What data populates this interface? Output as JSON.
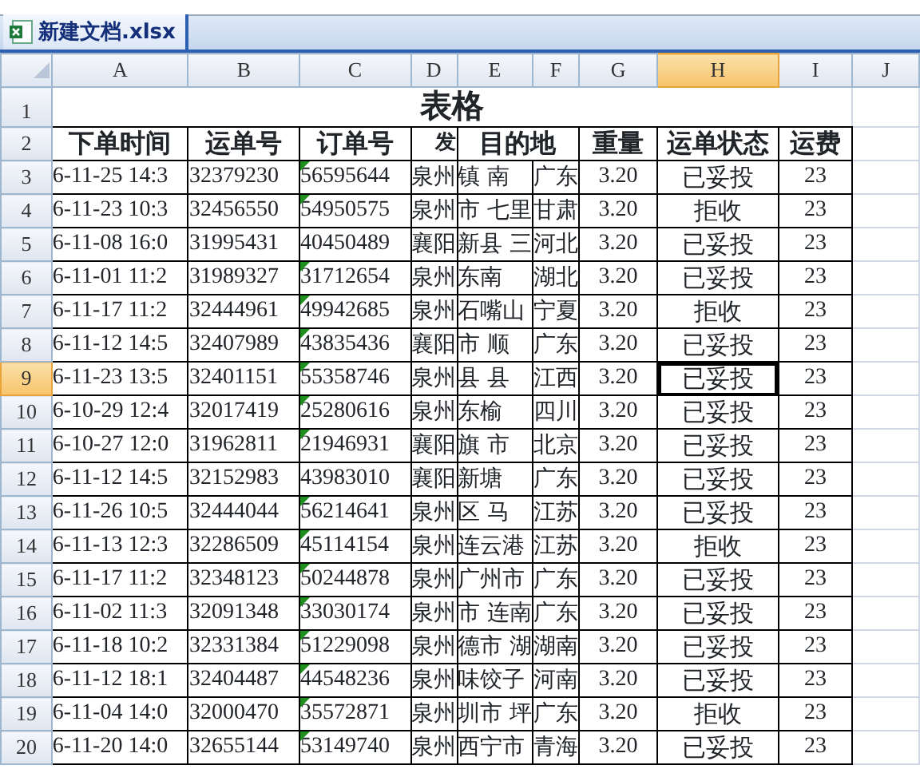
{
  "tab": {
    "label": "新建文档.xlsx",
    "selected": true
  },
  "columns": [
    {
      "label": "A",
      "selected": false
    },
    {
      "label": "B",
      "selected": false
    },
    {
      "label": "C",
      "selected": false
    },
    {
      "label": "D",
      "selected": false
    },
    {
      "label": "E",
      "selected": false
    },
    {
      "label": "F",
      "selected": false
    },
    {
      "label": "G",
      "selected": false
    },
    {
      "label": "H",
      "selected": true
    },
    {
      "label": "I",
      "selected": false
    },
    {
      "label": "J",
      "selected": false
    }
  ],
  "title_row": {
    "number": "1",
    "title": "表格"
  },
  "header_row": {
    "number": "2",
    "cells": [
      "下单时间",
      "运单号",
      "订单号",
      "发",
      "目的地",
      "重量",
      "运单状态",
      "运费"
    ]
  },
  "rows": [
    {
      "number": "3",
      "selected": false,
      "flagged": true,
      "cells": [
        "6-11-25 14:3",
        "32379230",
        "56595644",
        "泉州",
        "镇 南",
        "广东",
        "3.20",
        "已妥投",
        "23"
      ]
    },
    {
      "number": "4",
      "selected": false,
      "flagged": true,
      "cells": [
        "6-11-23 10:3",
        "32456550",
        "54950575",
        "泉州",
        "市 七里",
        "甘肃",
        "3.20",
        "拒收",
        "23"
      ]
    },
    {
      "number": "5",
      "selected": false,
      "flagged": false,
      "cells": [
        "6-11-08 16:0",
        "31995431",
        "40450489",
        "襄阳",
        "新县 三",
        "河北",
        "3.20",
        "已妥投",
        "23"
      ]
    },
    {
      "number": "6",
      "selected": false,
      "flagged": true,
      "cells": [
        "6-11-01 11:2",
        "31989327",
        "31712654",
        "泉州",
        "东南",
        "湖北",
        "3.20",
        "已妥投",
        "23"
      ]
    },
    {
      "number": "7",
      "selected": false,
      "flagged": true,
      "cells": [
        "6-11-17 11:2",
        "32444961",
        "49942685",
        "泉州",
        "石嘴山",
        "宁夏",
        "3.20",
        "拒收",
        "23"
      ]
    },
    {
      "number": "8",
      "selected": false,
      "flagged": true,
      "cells": [
        "6-11-12 14:5",
        "32407989",
        "43835436",
        "襄阳",
        "市 顺",
        "广东",
        "3.20",
        "已妥投",
        "23"
      ]
    },
    {
      "number": "9",
      "selected": true,
      "flagged": true,
      "cells": [
        "6-11-23 13:5",
        "32401151",
        "55358746",
        "泉州",
        "县 县",
        "江西",
        "3.20",
        "已妥投",
        "23"
      ]
    },
    {
      "number": "10",
      "selected": false,
      "flagged": true,
      "cells": [
        "6-10-29 12:4",
        "32017419",
        "25280616",
        "泉州",
        "东榆",
        "四川",
        "3.20",
        "已妥投",
        "23"
      ]
    },
    {
      "number": "11",
      "selected": false,
      "flagged": true,
      "cells": [
        "6-10-27 12:0",
        "31962811",
        "21946931",
        "襄阳",
        "旗 市",
        "北京",
        "3.20",
        "已妥投",
        "23"
      ]
    },
    {
      "number": "12",
      "selected": false,
      "flagged": false,
      "cells": [
        "6-11-12 14:5",
        "32152983",
        "43983010",
        "襄阳",
        "新塘",
        "广东",
        "3.20",
        "已妥投",
        "23"
      ]
    },
    {
      "number": "13",
      "selected": false,
      "flagged": true,
      "cells": [
        "6-11-26 10:5",
        "32444044",
        "56214641",
        "泉州",
        "区 马",
        "江苏",
        "3.20",
        "已妥投",
        "23"
      ]
    },
    {
      "number": "14",
      "selected": false,
      "flagged": true,
      "cells": [
        "6-11-13 12:3",
        "32286509",
        "45114154",
        "泉州",
        "连云港",
        "江苏",
        "3.20",
        "拒收",
        "23"
      ]
    },
    {
      "number": "15",
      "selected": false,
      "flagged": true,
      "cells": [
        "6-11-17 11:2",
        "32348123",
        "50244878",
        "泉州",
        "广州市",
        "广东",
        "3.20",
        "已妥投",
        "23"
      ]
    },
    {
      "number": "16",
      "selected": false,
      "flagged": true,
      "cells": [
        "6-11-02 11:3",
        "32091348",
        "33030174",
        "泉州",
        "市 连南",
        "广东",
        "3.20",
        "已妥投",
        "23"
      ]
    },
    {
      "number": "17",
      "selected": false,
      "flagged": true,
      "cells": [
        "6-11-18 10:2",
        "32331384",
        "51229098",
        "泉州",
        "德市 湖",
        "湖南",
        "3.20",
        "已妥投",
        "23"
      ]
    },
    {
      "number": "18",
      "selected": false,
      "flagged": true,
      "cells": [
        "6-11-12 18:1",
        "32404487",
        "44548236",
        "泉州",
        "味饺子",
        "河南",
        "3.20",
        "已妥投",
        "23"
      ]
    },
    {
      "number": "19",
      "selected": false,
      "flagged": true,
      "cells": [
        "6-11-04 14:0",
        "32000470",
        "35572871",
        "泉州",
        "圳市 坪",
        "广东",
        "3.20",
        "拒收",
        "23"
      ]
    },
    {
      "number": "20",
      "selected": false,
      "flagged": true,
      "cells": [
        "6-11-20 14:0",
        "32655144",
        "53149740",
        "泉州",
        "西宁市",
        "青海",
        "3.20",
        "已妥投",
        "23"
      ]
    }
  ]
}
